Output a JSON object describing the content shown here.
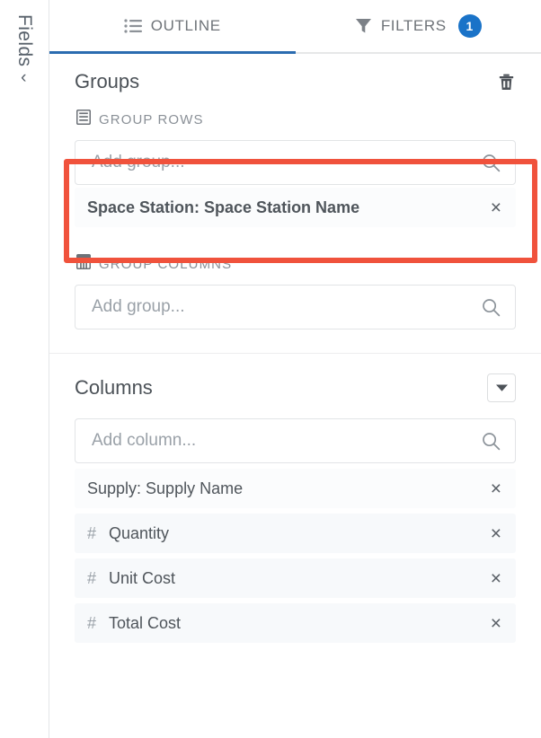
{
  "rail": {
    "label": "Fields",
    "chevron": "chevron-right"
  },
  "tabs": [
    {
      "label": "OUTLINE",
      "icon": "list-icon",
      "active": true,
      "badge": ""
    },
    {
      "label": "FILTERS",
      "icon": "funnel-icon",
      "active": false,
      "badge": "1"
    }
  ],
  "groups": {
    "title": "Groups",
    "delete_icon": "trash-icon",
    "group_rows": {
      "label": "GROUP ROWS",
      "icon": "rows-icon",
      "search_placeholder": "Add group...",
      "search_value": "",
      "search_icon": "search-icon",
      "items": [
        {
          "label": "Space Station: Space Station Name",
          "remove": "×"
        }
      ]
    },
    "group_columns": {
      "label": "GROUP COLUMNS",
      "icon": "columns-icon",
      "search_placeholder": "Add group...",
      "search_value": "",
      "search_icon": "search-icon",
      "items": []
    }
  },
  "columns": {
    "title": "Columns",
    "menu_icon": "chevron-down-icon",
    "search_placeholder": "Add column...",
    "search_value": "",
    "search_icon": "search-icon",
    "items": [
      {
        "prefix": "",
        "label": "Supply: Supply Name",
        "remove": "×"
      },
      {
        "prefix": "#",
        "label": "Quantity",
        "remove": "×"
      },
      {
        "prefix": "#",
        "label": "Unit Cost",
        "remove": "×"
      },
      {
        "prefix": "#",
        "label": "Total Cost",
        "remove": "×"
      }
    ]
  },
  "annotation": {
    "color": "#f0523c",
    "target": "group-rows-area"
  }
}
